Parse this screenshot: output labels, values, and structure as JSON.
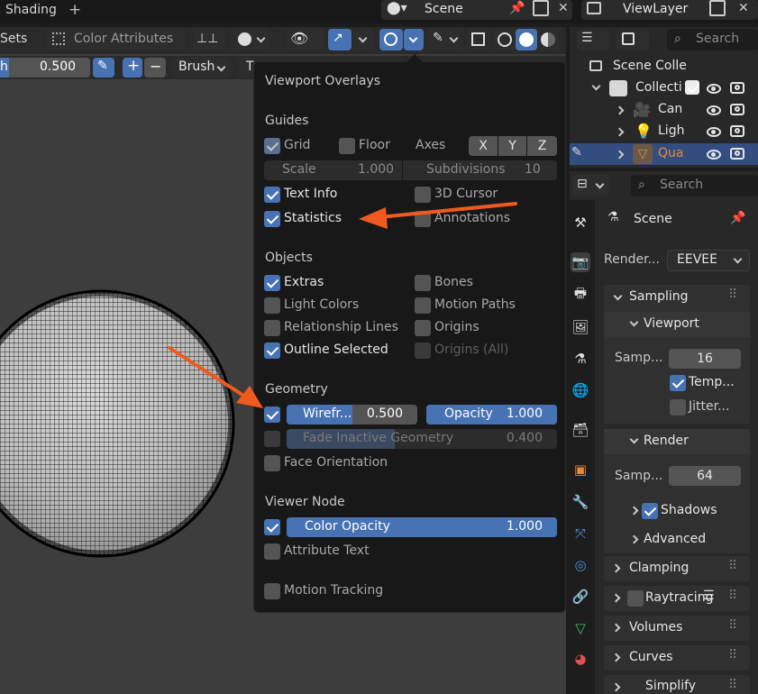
{
  "topbar": {
    "workspace_tab": "Shading",
    "add_tab": "+",
    "scene_name": "Scene",
    "viewlayer_name": "ViewLayer"
  },
  "viewport_header": {
    "sets_label": "Sets",
    "color_attributes": "Color Attributes",
    "search_placeholder": "Search"
  },
  "tool_header": {
    "strength_label": "h",
    "strength_value": "0.500",
    "plus": "+",
    "minus": "−",
    "brush_label": "Brush",
    "t_label": "T"
  },
  "overlays": {
    "title": "Viewport Overlays",
    "guides": {
      "heading": "Guides",
      "grid": "Grid",
      "grid_checked": true,
      "floor": "Floor",
      "floor_checked": false,
      "axes": "Axes",
      "x": "X",
      "y": "Y",
      "z": "Z",
      "scale_label": "Scale",
      "scale_value": "1.000",
      "subdiv_label": "Subdivisions",
      "subdiv_value": "10",
      "text_info": "Text Info",
      "text_info_checked": true,
      "cursor_3d": "3D Cursor",
      "cursor_3d_checked": false,
      "statistics": "Statistics",
      "statistics_checked": true,
      "annotations": "Annotations",
      "annotations_checked": false
    },
    "objects": {
      "heading": "Objects",
      "extras": "Extras",
      "extras_checked": true,
      "bones": "Bones",
      "bones_checked": false,
      "light_colors": "Light Colors",
      "light_colors_checked": false,
      "motion_paths": "Motion Paths",
      "motion_paths_checked": false,
      "relationship_lines": "Relationship Lines",
      "relationship_lines_checked": false,
      "origins": "Origins",
      "origins_checked": false,
      "outline_selected": "Outline Selected",
      "outline_selected_checked": true,
      "origins_all": "Origins (All)",
      "origins_all_checked": false
    },
    "geometry": {
      "heading": "Geometry",
      "wireframe_checked": true,
      "wireframe_label": "Wirefr...",
      "wireframe_value": "0.500",
      "wireframe_fill": 0.5,
      "opacity_label": "Opacity",
      "opacity_value": "1.000",
      "opacity_fill": 1.0,
      "fade_inactive_checked": false,
      "fade_inactive_label": "Fade Inactive Geometry",
      "fade_inactive_value": "0.400",
      "fade_inactive_fill": 0.4,
      "face_orientation": "Face Orientation",
      "face_orientation_checked": false
    },
    "viewer_node": {
      "heading": "Viewer Node",
      "color_opacity_checked": true,
      "color_opacity_label": "Color Opacity",
      "color_opacity_value": "1.000",
      "color_opacity_fill": 1.0,
      "attribute_text": "Attribute Text",
      "attribute_text_checked": false
    },
    "motion_tracking": "Motion Tracking",
    "motion_tracking_checked": false
  },
  "outliner": {
    "search_placeholder": "Search",
    "scene_collection": "Scene Colle",
    "collection": "Collecti",
    "camera": "Can",
    "light": "Ligh",
    "object": "Qua"
  },
  "properties": {
    "search_placeholder": "Search",
    "scene_label": "Scene",
    "render_engine_label": "Render...",
    "render_engine_value": "EEVEE",
    "sampling": "Sampling",
    "viewport": "Viewport",
    "viewport_samples_label": "Samp...",
    "viewport_samples_value": "16",
    "temporal": "Temp...",
    "temporal_checked": true,
    "jitter": "Jitter...",
    "jitter_checked": false,
    "render": "Render",
    "render_samples_label": "Samp...",
    "render_samples_value": "64",
    "shadows": "Shadows",
    "shadows_checked": true,
    "advanced": "Advanced",
    "clamping": "Clamping",
    "raytracing": "Raytracing",
    "raytracing_checked": false,
    "volumes": "Volumes",
    "curves": "Curves",
    "simplify": "Simplify"
  },
  "colors": {
    "accent": "#4772b3",
    "arrow": "#f05a1e",
    "panel_bg": "#181818"
  }
}
